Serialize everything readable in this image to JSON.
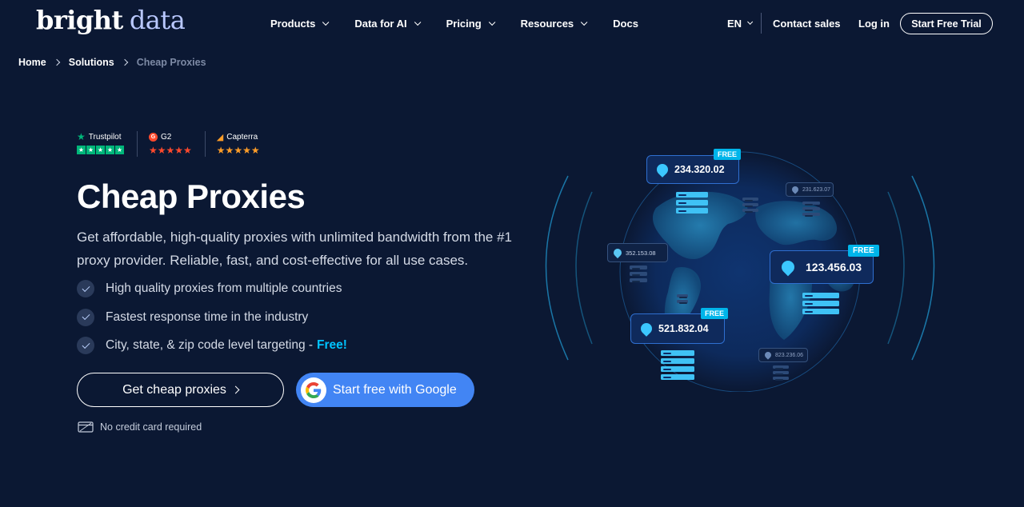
{
  "brand": {
    "word1": "bright",
    "word2": "data"
  },
  "nav": {
    "items": [
      {
        "label": "Products"
      },
      {
        "label": "Data for AI"
      },
      {
        "label": "Pricing"
      },
      {
        "label": "Resources"
      },
      {
        "label": "Docs"
      }
    ],
    "lang": "EN",
    "contact": "Contact sales",
    "login": "Log in",
    "trial": "Start Free Trial"
  },
  "breadcrumb": {
    "home": "Home",
    "solutions": "Solutions",
    "current": "Cheap Proxies"
  },
  "ratings": {
    "trustpilot": "Trustpilot",
    "g2": "G2",
    "capterra": "Capterra",
    "stars": 5
  },
  "hero": {
    "title": "Cheap Proxies",
    "description": "Get affordable, high-quality proxies with unlimited bandwidth from the #1 proxy provider. Reliable, fast, and cost-effective for all use cases.",
    "features": [
      {
        "text": "High quality proxies from multiple countries",
        "highlight": ""
      },
      {
        "text": "Fastest response time in the industry",
        "highlight": ""
      },
      {
        "text": "City, state, & zip code level targeting -",
        "highlight": "Free!"
      }
    ],
    "cta_primary": "Get cheap proxies",
    "cta_google": "Start free with Google",
    "note": "No credit card required"
  },
  "globe": {
    "labels": [
      {
        "ip": "234.320.02",
        "tag": "FREE"
      },
      {
        "ip": "123.456.03",
        "tag": "FREE"
      },
      {
        "ip": "521.832.04",
        "tag": "FREE"
      }
    ],
    "small_labels": [
      "231.623.07",
      "352.153.08",
      "823.236.06"
    ]
  },
  "colors": {
    "background": "#0b1833",
    "accent": "#00c2ff",
    "google_blue": "#4285f4",
    "trustpilot": "#00b67a",
    "g2": "#ff492c",
    "capterra": "#ff9d28"
  }
}
